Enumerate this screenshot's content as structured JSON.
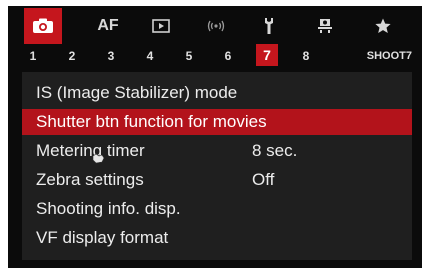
{
  "tabs": [
    {
      "name": "shooting",
      "icon": "camera-icon",
      "label": "",
      "active": true
    },
    {
      "name": "af",
      "icon": "",
      "label": "AF",
      "active": false
    },
    {
      "name": "playback",
      "icon": "playback-icon",
      "label": "",
      "active": false
    },
    {
      "name": "wireless",
      "icon": "wireless-icon",
      "label": "",
      "active": false
    },
    {
      "name": "setup",
      "icon": "wrench-icon",
      "label": "",
      "active": false
    },
    {
      "name": "custom",
      "icon": "custom-functions-icon",
      "label": "",
      "active": false
    },
    {
      "name": "mymenu",
      "icon": "star-icon",
      "label": "",
      "active": false
    }
  ],
  "pages": [
    "1",
    "2",
    "3",
    "4",
    "5",
    "6",
    "7",
    "8"
  ],
  "active_page": "7",
  "page_name": "SHOOT7",
  "menu_items": [
    {
      "label": "IS (Image Stabilizer) mode",
      "value": ""
    },
    {
      "label": "Shutter btn function for movies",
      "value": ""
    },
    {
      "label": "Metering timer",
      "value": "8 sec."
    },
    {
      "label": "Zebra settings",
      "value": "Off"
    },
    {
      "label": "Shooting info. disp.",
      "value": ""
    },
    {
      "label": "VF display format",
      "value": ""
    }
  ],
  "selected_item": "Shutter btn function for movies",
  "colors": {
    "accent": "#c5161d",
    "selected_row": "#b3131b",
    "background": "#0b0b0b",
    "menu_bg": "#1f1f1f"
  }
}
